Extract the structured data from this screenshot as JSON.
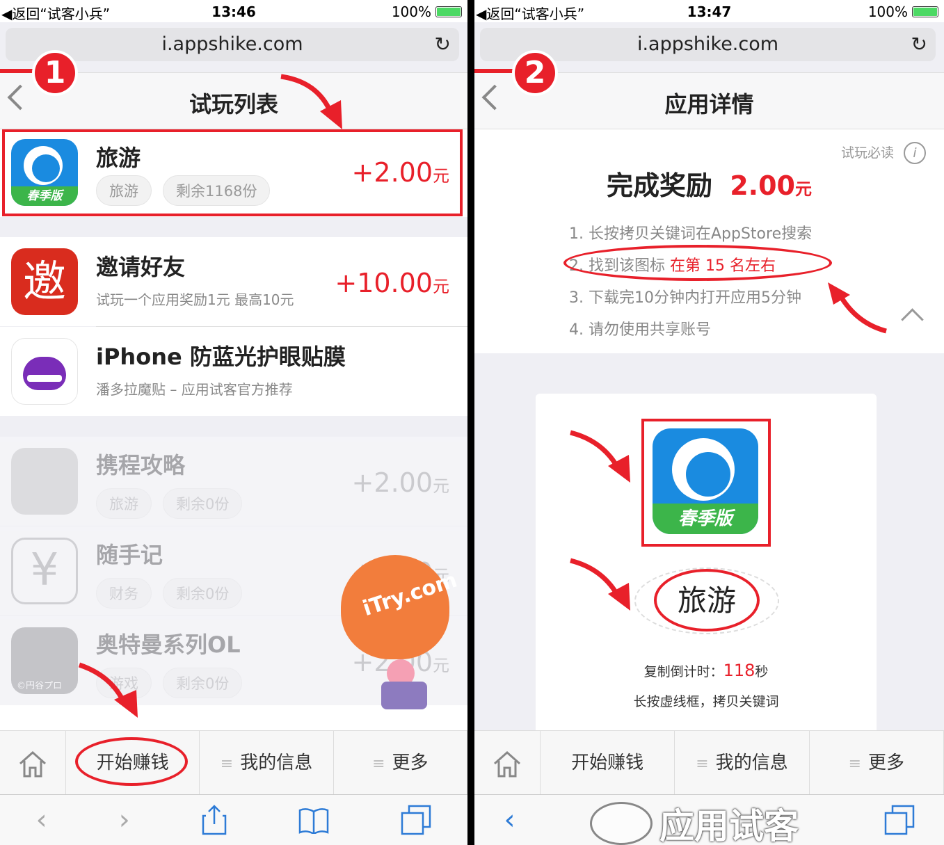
{
  "left": {
    "status": {
      "back": "◀返回“试客小兵”",
      "time": "13:46",
      "battery": "100%"
    },
    "url": "i.appshike.com",
    "nav_title": "试玩列表",
    "step": "1",
    "featured": {
      "name": "旅游",
      "tags": [
        "旅游",
        "剩余1168份"
      ],
      "price": "+2.00",
      "unit": "元",
      "icon_text": "春季版"
    },
    "invite": {
      "name": "邀请好友",
      "sub": "试玩一个应用奖励1元 最高10元",
      "price": "+10.00",
      "unit": "元",
      "icon_text": "邀"
    },
    "ad": {
      "name": "iPhone 防蓝光护眼贴膜",
      "sub": "潘多拉魔贴 – 应用试客官方推荐"
    },
    "disabled": [
      {
        "name": "携程攻略",
        "tags": [
          "旅游",
          "剩余0份"
        ],
        "price": "+2.00",
        "unit": "元"
      },
      {
        "name": "随手记",
        "tags": [
          "财务",
          "剩余0份"
        ],
        "price": "+2.00",
        "unit": "元"
      },
      {
        "name": "奥特曼系列OL",
        "tags": [
          "游戏",
          "剩余0份"
        ],
        "price": "+2.00",
        "unit": "元",
        "icon_caption": "©円谷プロ"
      }
    ],
    "balloon_text": "iTry.com",
    "tabs": [
      "开始赚钱",
      "我的信息",
      "更多"
    ]
  },
  "right": {
    "status": {
      "back": "◀返回“试客小兵”",
      "time": "13:47",
      "battery": "100%"
    },
    "url": "i.appshike.com",
    "nav_title": "应用详情",
    "step": "2",
    "must_read": "试玩必读",
    "reward_label": "完成奖励",
    "reward_value": "2.00",
    "reward_unit": "元",
    "rules": [
      "1. 长按拷贝关键词在AppStore搜索",
      "2. 找到该图标",
      "3. 下载完10分钟内打开应用5分钟",
      "4. 请勿使用共享账号"
    ],
    "rank_note": "在第 15 名左右",
    "icon_text": "春季版",
    "keyword": "旅游",
    "countdown_label": "复制倒计时：",
    "countdown_value": "118",
    "countdown_unit": "秒",
    "hint": "长按虚线框，拷贝关键词",
    "tabs": [
      "开始赚钱",
      "我的信息",
      "更多"
    ],
    "watermark": "应用试客"
  },
  "colors": {
    "accent_red": "#e8202a",
    "ios_blue": "#2d7bd6",
    "ctrip_blue": "#1a8be0",
    "ctrip_green": "#3cb54a"
  }
}
